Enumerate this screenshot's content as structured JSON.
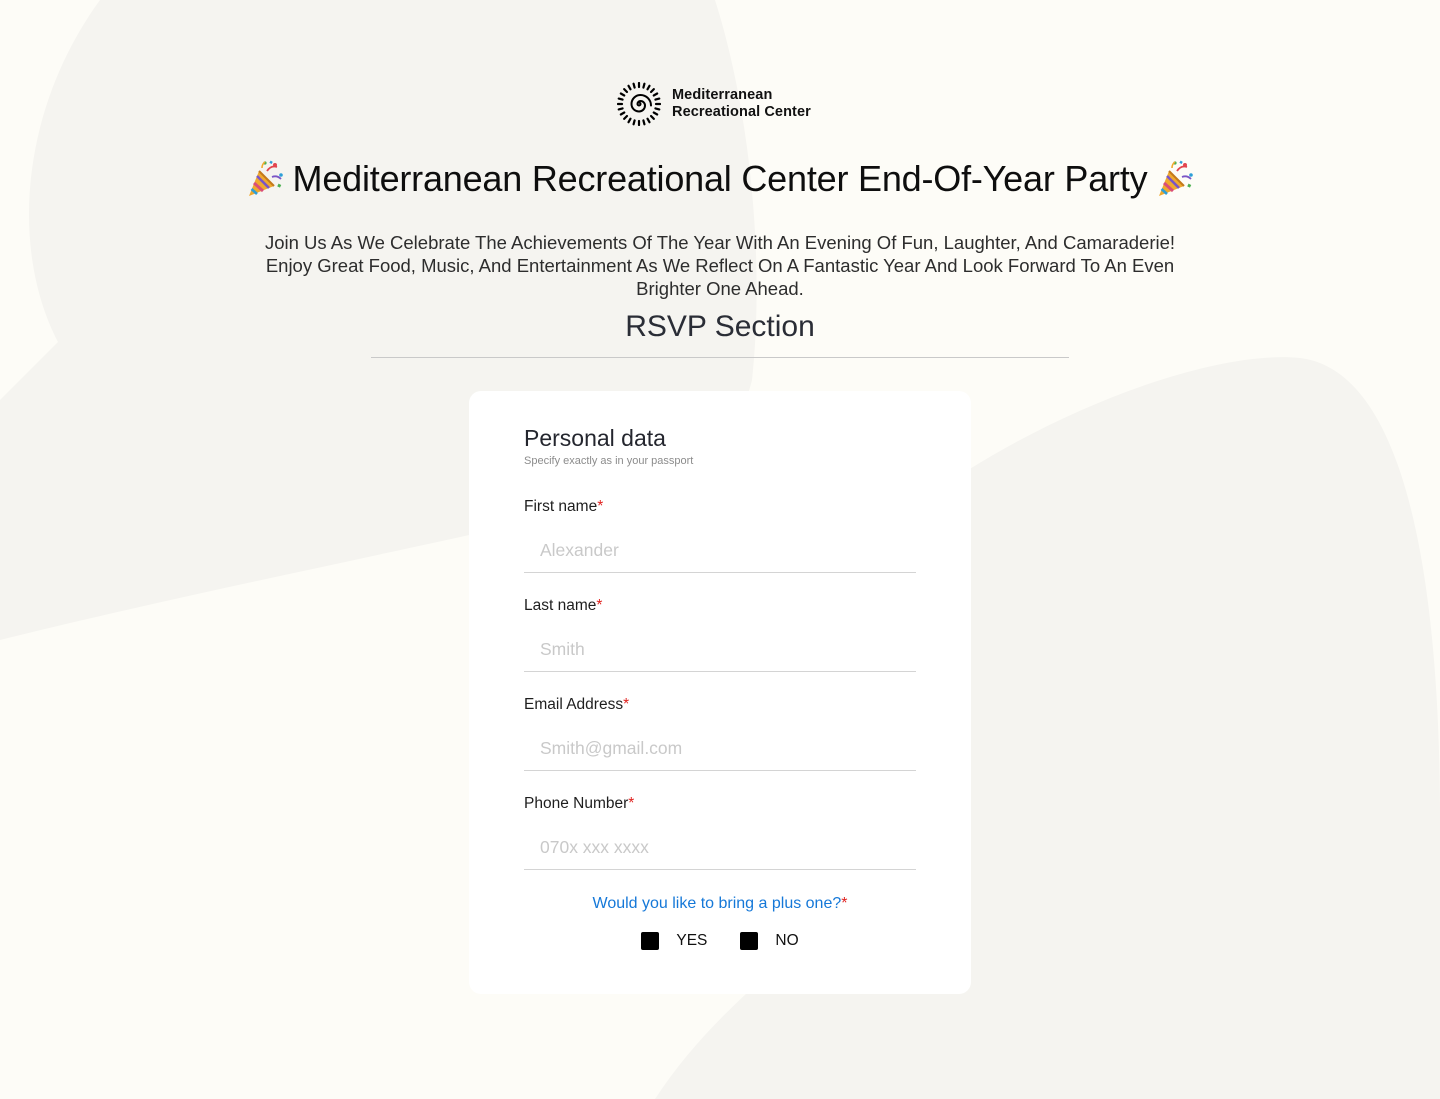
{
  "brand": {
    "name_line1": "Mediterranean",
    "name_line2": "Recreational Center",
    "logo_icon": "spiral-sun-logo"
  },
  "header": {
    "title": "Mediterranean Recreational Center End-Of-Year Party",
    "title_icon": "party-popper-icon",
    "intro": "Join Us As We Celebrate The Achievements Of The Year With An Evening Of Fun, Laughter, And Camaraderie! Enjoy Great Food, Music, And Entertainment As We Reflect On A Fantastic Year And Look Forward To An Even Brighter One Ahead."
  },
  "rsvp": {
    "section_title": "RSVP Section"
  },
  "form": {
    "title": "Personal data",
    "subtitle": "Specify exactly as in your passport",
    "required_marker": "*",
    "fields": [
      {
        "label": "First name",
        "value": "",
        "placeholder": "Alexander"
      },
      {
        "label": "Last name",
        "value": "",
        "placeholder": "Smith"
      },
      {
        "label": "Email Address",
        "value": "",
        "placeholder": "Smith@gmail.com"
      },
      {
        "label": "Phone Number",
        "value": "",
        "placeholder": "070x xxx xxxx"
      }
    ],
    "plus_one": {
      "question": "Would you like to bring a plus one?",
      "options": [
        {
          "label": "YES",
          "checked": false
        },
        {
          "label": "NO",
          "checked": false
        }
      ]
    }
  },
  "colors": {
    "background": "#fdfcf7",
    "background_shape": "#f5f4f0",
    "card": "#ffffff",
    "accent_blue": "#1578d8",
    "required_red": "#e0201d"
  }
}
